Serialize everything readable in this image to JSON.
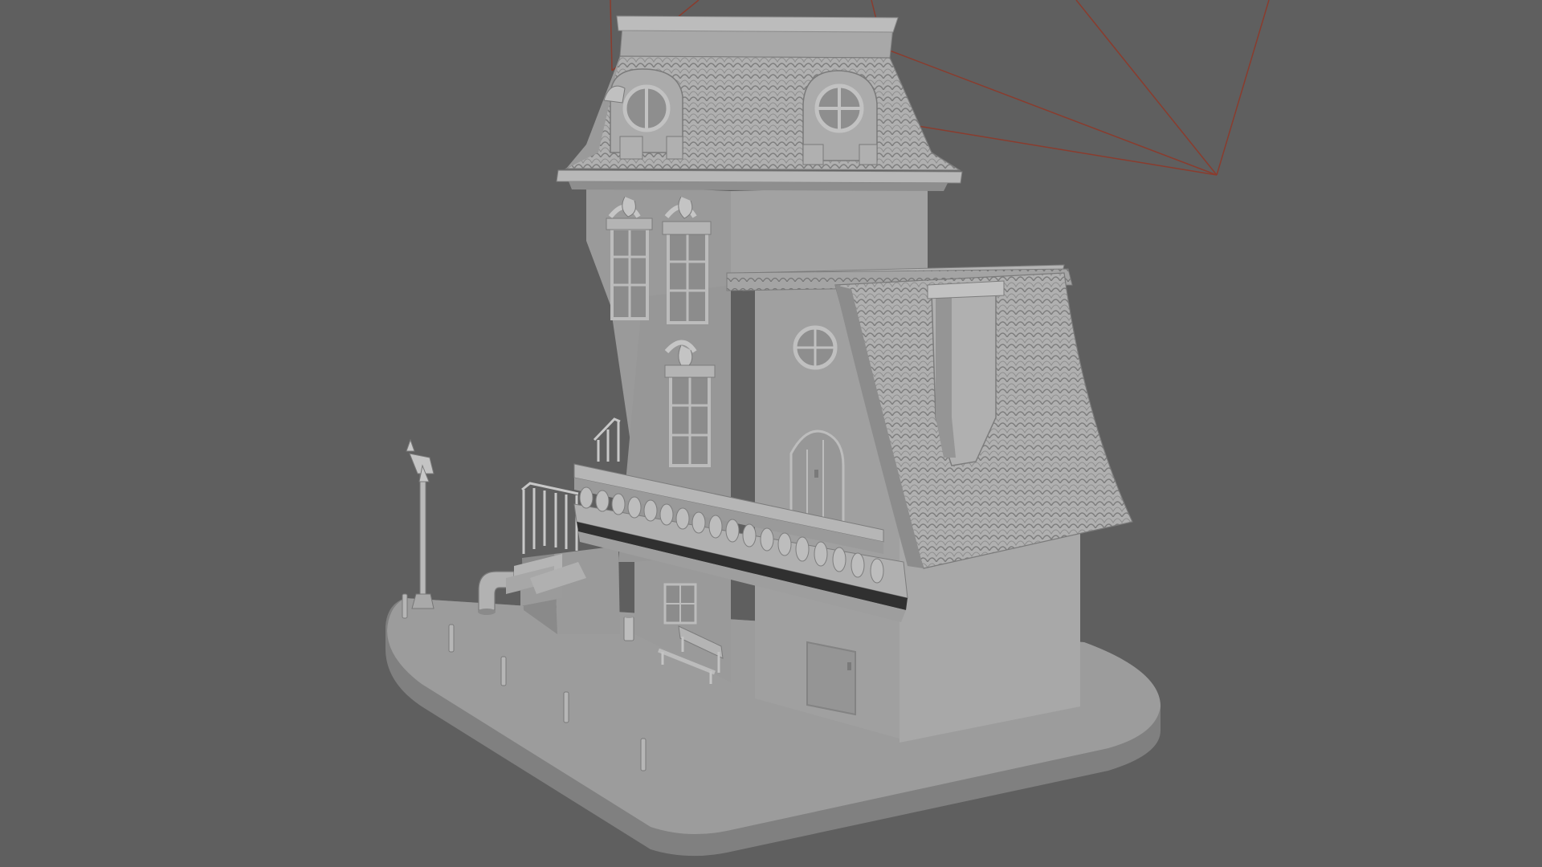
{
  "viewport": {
    "background": "#5f5f5f",
    "scene": "clay-render-victorian-house-model",
    "camera_frustum_color": "#8a3c2e",
    "clay_light": "#b8b8b8",
    "clay_mid": "#9e9e9e",
    "clay_dark": "#7c7c7c"
  }
}
